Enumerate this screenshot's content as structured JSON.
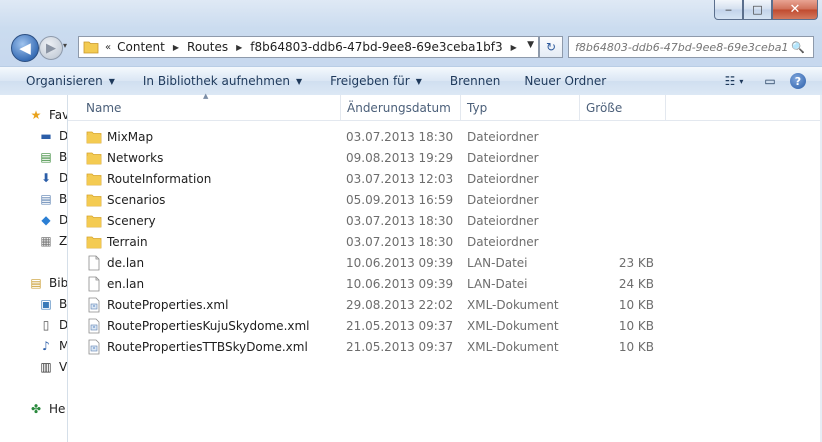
{
  "window": {
    "minimize_icon": "minimize-icon",
    "maximize_icon": "maximize-icon",
    "close_icon": "close-icon",
    "min_glyph": "‒",
    "max_glyph": "□",
    "close_glyph": "✕"
  },
  "navigation": {
    "back_glyph": "◀",
    "forward_glyph": "▶",
    "history_glyph": "▾",
    "breadcrumb_prefix": "«",
    "breadcrumbs": [
      "Content",
      "Routes",
      "f8b64803-ddb6-47bd-9ee8-69e3ceba1bf3"
    ],
    "crumb_arrow": "▶",
    "address_dropdown_glyph": "▼",
    "refresh_glyph": "↻",
    "search_placeholder": "f8b64803-ddb6-47bd-9ee8-69e3ceba1...",
    "search_glyph": "🔍"
  },
  "commandbar": {
    "organize": "Organisieren",
    "include_library": "In Bibliothek aufnehmen",
    "share_with": "Freigeben für",
    "burn": "Brennen",
    "new_folder": "Neuer Ordner",
    "dropdown_glyph": "▼",
    "view_glyph": "☷",
    "view_dd": "▾",
    "preview_glyph": "▭",
    "help_glyph": "?"
  },
  "navpane": {
    "items": [
      {
        "label": "Fav",
        "icon": "star-icon",
        "glyph": "★",
        "color": "#e9a21b"
      },
      {
        "label": "D",
        "icon": "desktop-icon",
        "glyph": "▬",
        "color": "#2b5ea8"
      },
      {
        "label": "B",
        "icon": "libraries-icon",
        "glyph": "▤",
        "color": "#3a8a3a"
      },
      {
        "label": "D",
        "icon": "downloads-icon",
        "glyph": "⬇",
        "color": "#2b5ea8"
      },
      {
        "label": "B",
        "icon": "recent-icon",
        "glyph": "▤",
        "color": "#5a7fb0"
      },
      {
        "label": "D",
        "icon": "dropbox-icon",
        "glyph": "◆",
        "color": "#2b7fd4"
      },
      {
        "label": "Z",
        "icon": "recent-places-icon",
        "glyph": "▦",
        "color": "#777777"
      },
      {
        "label": "Bibl",
        "icon": "libraries-icon",
        "glyph": "▤",
        "color": "#c89a2c"
      },
      {
        "label": "B",
        "icon": "pictures-icon",
        "glyph": "▣",
        "color": "#3a7ab8"
      },
      {
        "label": "D",
        "icon": "documents-icon",
        "glyph": "▯",
        "color": "#555555"
      },
      {
        "label": "M",
        "icon": "music-icon",
        "glyph": "♪",
        "color": "#2b5ea8"
      },
      {
        "label": "V",
        "icon": "videos-icon",
        "glyph": "▥",
        "color": "#333333"
      },
      {
        "label": "He",
        "icon": "homegroup-icon",
        "glyph": "✤",
        "color": "#2b8a3e"
      }
    ]
  },
  "columns": {
    "name": "Name",
    "date": "Änderungsdatum",
    "type": "Typ",
    "size": "Größe",
    "sort_glyph": "▲"
  },
  "files": [
    {
      "name": "MixMap",
      "date": "03.07.2013 18:30",
      "type": "Dateiordner",
      "size": "",
      "kind": "folder"
    },
    {
      "name": "Networks",
      "date": "09.08.2013 19:29",
      "type": "Dateiordner",
      "size": "",
      "kind": "folder"
    },
    {
      "name": "RouteInformation",
      "date": "03.07.2013 12:03",
      "type": "Dateiordner",
      "size": "",
      "kind": "folder"
    },
    {
      "name": "Scenarios",
      "date": "05.09.2013 16:59",
      "type": "Dateiordner",
      "size": "",
      "kind": "folder"
    },
    {
      "name": "Scenery",
      "date": "03.07.2013 18:30",
      "type": "Dateiordner",
      "size": "",
      "kind": "folder"
    },
    {
      "name": "Terrain",
      "date": "03.07.2013 18:30",
      "type": "Dateiordner",
      "size": "",
      "kind": "folder"
    },
    {
      "name": "de.lan",
      "date": "10.06.2013 09:39",
      "type": "LAN-Datei",
      "size": "23 KB",
      "kind": "file"
    },
    {
      "name": "en.lan",
      "date": "10.06.2013 09:39",
      "type": "LAN-Datei",
      "size": "24 KB",
      "kind": "file"
    },
    {
      "name": "RouteProperties.xml",
      "date": "29.08.2013 22:02",
      "type": "XML-Dokument",
      "size": "10 KB",
      "kind": "xml"
    },
    {
      "name": "RoutePropertiesKujuSkydome.xml",
      "date": "21.05.2013 09:37",
      "type": "XML-Dokument",
      "size": "10 KB",
      "kind": "xml"
    },
    {
      "name": "RoutePropertiesTTBSkyDome.xml",
      "date": "21.05.2013 09:37",
      "type": "XML-Dokument",
      "size": "10 KB",
      "kind": "xml"
    }
  ],
  "colors": {
    "folder": "#f3cb52",
    "folder_dark": "#d8a42a"
  }
}
